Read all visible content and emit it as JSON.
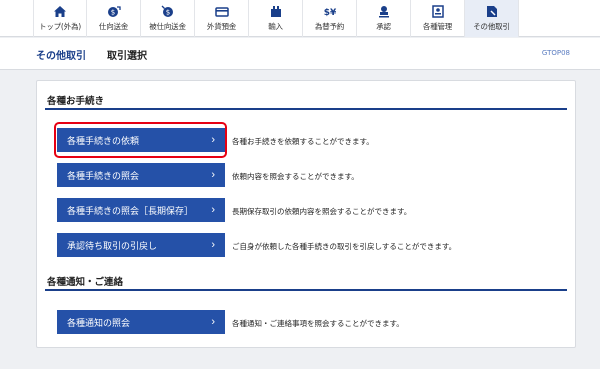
{
  "nav": {
    "items": [
      {
        "label": "トップ(外為)",
        "icon": "home-icon"
      },
      {
        "label": "仕向送金",
        "icon": "outgoing-remittance-icon"
      },
      {
        "label": "被仕向送金",
        "icon": "incoming-remittance-icon"
      },
      {
        "label": "外貨預金",
        "icon": "foreign-deposit-icon"
      },
      {
        "label": "輸入",
        "icon": "import-icon"
      },
      {
        "label": "為替予約",
        "icon": "exchange-contract-icon"
      },
      {
        "label": "承認",
        "icon": "approval-icon"
      },
      {
        "label": "各種管理",
        "icon": "management-icon"
      },
      {
        "label": "その他取引",
        "icon": "other-transactions-icon"
      }
    ],
    "active_index": 8
  },
  "header": {
    "title": "その他取引",
    "page": "取引選択",
    "code": "GTOP08"
  },
  "sections": [
    {
      "title": "各種お手続き",
      "rows": [
        {
          "button": "各種手続きの依頼",
          "desc": "各種お手続きを依頼することができます。"
        },
        {
          "button": "各種手続きの照会",
          "desc": "依頼内容を照会することができます。"
        },
        {
          "button": "各種手続きの照会［長期保存］",
          "desc": "長期保存取引の依頼内容を照会することができます。"
        },
        {
          "button": "承認待ち取引の引戻し",
          "desc": "ご自身が依頼した各種手続きの取引を引戻しすることができます。"
        }
      ]
    },
    {
      "title": "各種通知・ご連絡",
      "rows": [
        {
          "button": "各種通知の照会",
          "desc": "各種通知・ご連絡事項を照会することができます。"
        }
      ]
    }
  ],
  "colors": {
    "accent": "#2551a8",
    "highlight": "#e60012"
  }
}
